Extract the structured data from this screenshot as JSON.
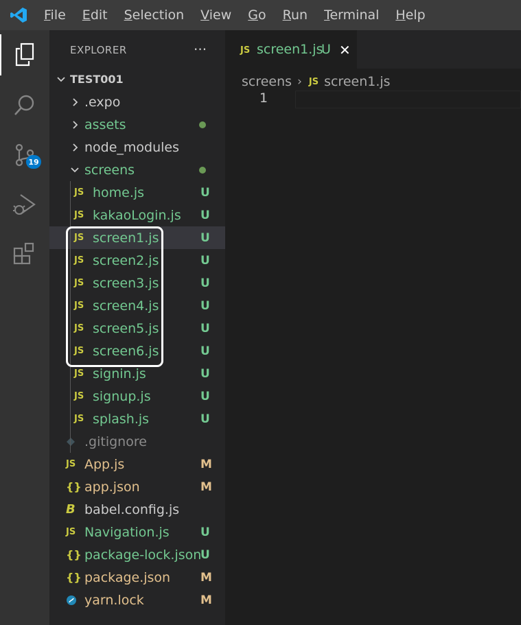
{
  "menu": [
    "File",
    "Edit",
    "Selection",
    "View",
    "Go",
    "Run",
    "Terminal",
    "Help"
  ],
  "activity_bar": {
    "items": [
      "explorer-icon",
      "search-icon",
      "source-control-icon",
      "run-debug-icon",
      "extensions-icon"
    ],
    "source_control_badge": "19"
  },
  "explorer": {
    "title": "EXPLORER",
    "more": "···",
    "root": "TEST001",
    "items": [
      {
        "label": ".expo",
        "kind": "folder",
        "open": false,
        "status": "",
        "dot": false
      },
      {
        "label": "assets",
        "kind": "folder",
        "open": false,
        "status": "",
        "dot": true
      },
      {
        "label": "node_modules",
        "kind": "folder",
        "open": false,
        "status": "",
        "dot": false
      },
      {
        "label": "screens",
        "kind": "folder",
        "open": true,
        "status": "",
        "dot": true
      },
      {
        "label": "home.js",
        "kind": "js",
        "status": "U"
      },
      {
        "label": "kakaoLogin.js",
        "kind": "js",
        "status": "U"
      },
      {
        "label": "screen1.js",
        "kind": "js",
        "status": "U",
        "selected": true
      },
      {
        "label": "screen2.js",
        "kind": "js",
        "status": "U"
      },
      {
        "label": "screen3.js",
        "kind": "js",
        "status": "U"
      },
      {
        "label": "screen4.js",
        "kind": "js",
        "status": "U"
      },
      {
        "label": "screen5.js",
        "kind": "js",
        "status": "U"
      },
      {
        "label": "screen6.js",
        "kind": "js",
        "status": "U"
      },
      {
        "label": "signin.js",
        "kind": "js",
        "status": "U"
      },
      {
        "label": "signup.js",
        "kind": "js",
        "status": "U"
      },
      {
        "label": "splash.js",
        "kind": "js",
        "status": "U"
      },
      {
        "label": ".gitignore",
        "kind": "git",
        "status": ""
      },
      {
        "label": "App.js",
        "kind": "js",
        "status": "M"
      },
      {
        "label": "app.json",
        "kind": "json",
        "status": "M"
      },
      {
        "label": "babel.config.js",
        "kind": "babel",
        "status": ""
      },
      {
        "label": "Navigation.js",
        "kind": "js",
        "status": "U"
      },
      {
        "label": "package-lock.json",
        "kind": "json",
        "status": "U"
      },
      {
        "label": "package.json",
        "kind": "json",
        "status": "M"
      },
      {
        "label": "yarn.lock",
        "kind": "yarn",
        "status": "M"
      }
    ]
  },
  "editor": {
    "tab": {
      "icon": "JS",
      "label": "screen1.js",
      "status": "U",
      "close": "✕"
    },
    "breadcrumb": {
      "folder": "screens",
      "sep": "›",
      "icon": "JS",
      "file": "screen1.js"
    },
    "line_number": "1"
  },
  "colors": {
    "untracked": "#73c991",
    "modified": "#e2c08d",
    "ignored": "#8c8c8c",
    "normal": "#cccccc",
    "js_icon": "#cbcb41",
    "accent": "#007acc"
  }
}
